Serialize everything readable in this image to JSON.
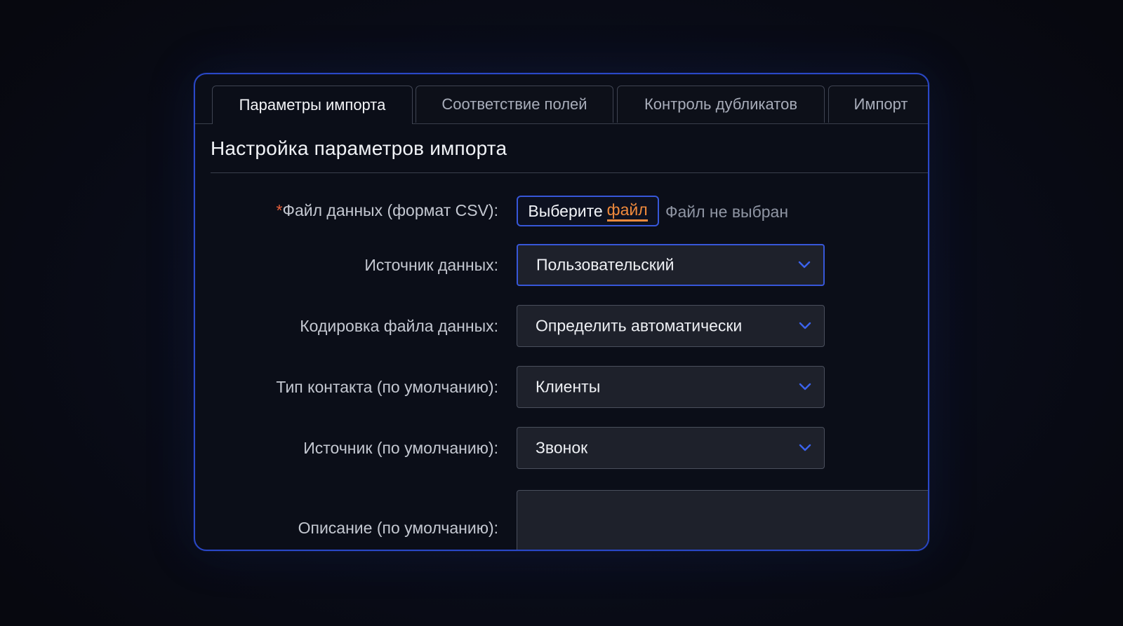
{
  "tabs": [
    {
      "label": "Параметры импорта",
      "active": true
    },
    {
      "label": "Соответствие полей",
      "active": false
    },
    {
      "label": "Контроль дубликатов",
      "active": false
    },
    {
      "label": "Импорт",
      "active": false
    }
  ],
  "section_title": "Настройка параметров импорта",
  "form": {
    "file": {
      "required_mark": "*",
      "label": "Файл данных (формат CSV):",
      "button_text": "Выберите",
      "button_accent": "файл",
      "status": "Файл не выбран"
    },
    "data_source": {
      "label": "Источник данных:",
      "value": "Пользовательский"
    },
    "encoding": {
      "label": "Кодировка файла данных:",
      "value": "Определить автоматически"
    },
    "contact_type": {
      "label": "Тип контакта (по умолчанию):",
      "value": "Клиенты"
    },
    "source": {
      "label": "Источник (по умолчанию):",
      "value": "Звонок"
    },
    "description": {
      "label": "Описание (по умолчанию):",
      "value": ""
    }
  },
  "icons": {
    "select_arrow": "chevron-down-icon"
  },
  "colors": {
    "accent_blue": "#3757d9",
    "accent_orange": "#f08a3c",
    "required_red": "#e8613c",
    "panel_border": "#2a48c8"
  }
}
